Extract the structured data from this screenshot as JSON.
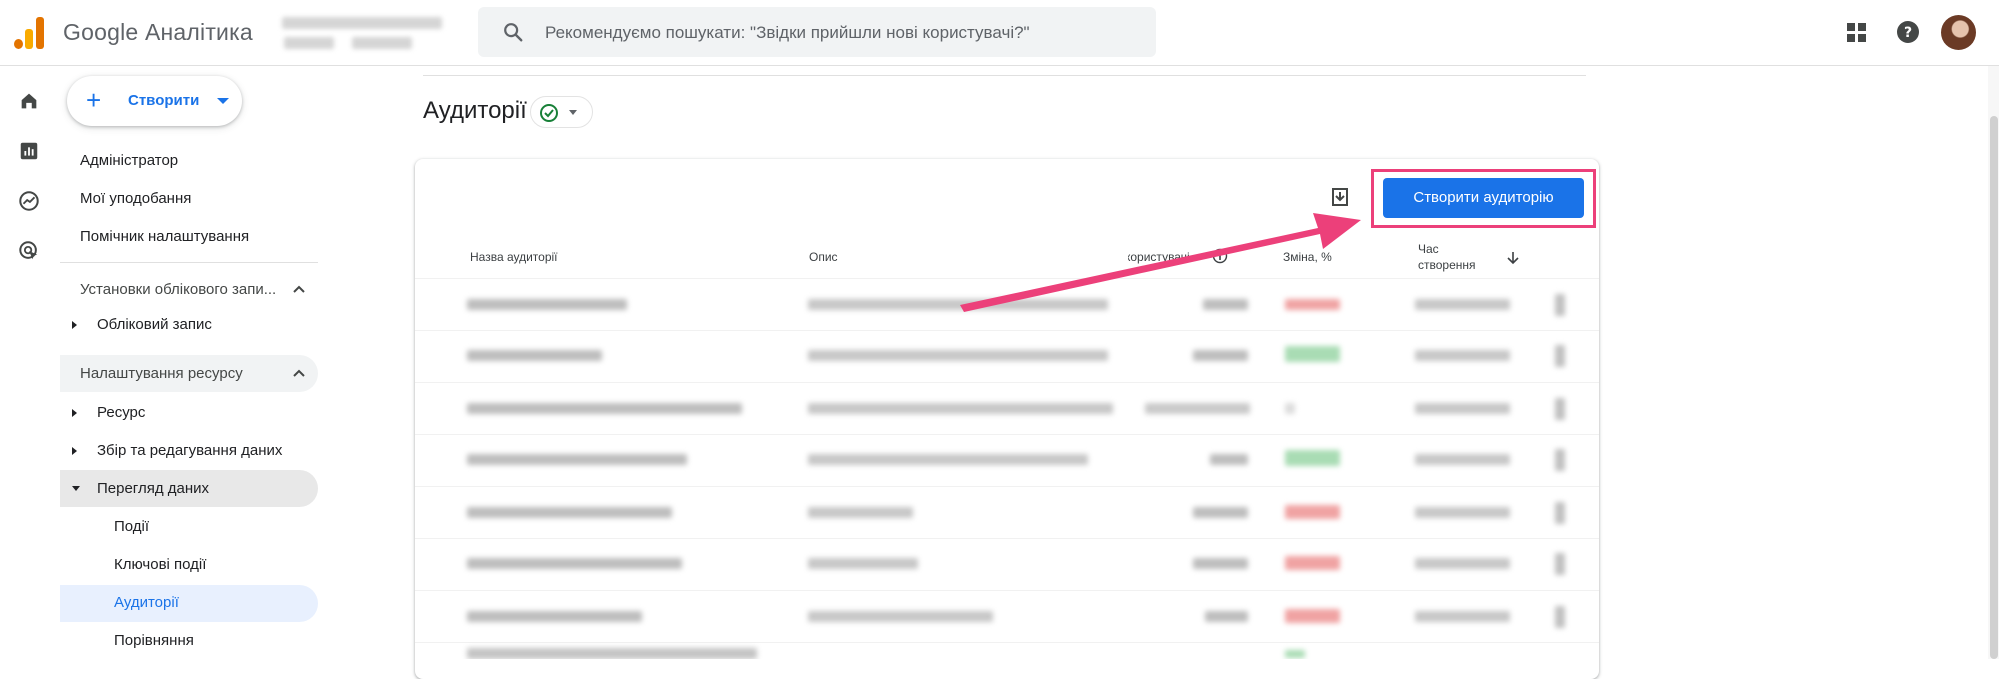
{
  "header": {
    "app_title": "Google Аналітика",
    "search_placeholder": "Рекомендуємо пошукати: \"Звідки прийшли нові користувачі?\""
  },
  "nav": {
    "create_label": "Створити",
    "items": [
      "Адміністратор",
      "Мої уподобання",
      "Помічник налаштування"
    ],
    "account_section": "Установки облікового запи...",
    "account_item": "Обліковий запис",
    "property_section": "Налаштування ресурсу",
    "property_items": [
      "Ресурс",
      "Збір та редагування даних",
      "Перегляд даних"
    ],
    "data_display_children": [
      "Події",
      "Ключові події",
      "Аудиторії",
      "Порівняння"
    ],
    "selected": "Аудиторії"
  },
  "main": {
    "page_title": "Аудиторії",
    "create_audience_label": "Створити аудиторію",
    "columns": {
      "name": "Назва аудиторії",
      "description": "Опис",
      "users": "користувачі",
      "change": "Зміна, %",
      "created_line1": "Час",
      "created_line2": "створення"
    },
    "rows": [
      {
        "change": "negative"
      },
      {
        "change": "positive"
      },
      {
        "change": "none"
      },
      {
        "change": "positive"
      },
      {
        "change": "negative"
      },
      {
        "change": "negative"
      },
      {
        "change": "negative"
      },
      {
        "change": "positive"
      }
    ]
  },
  "colors": {
    "accent": "#1a73e8",
    "highlight": "#ec407a",
    "selected_nav_bg": "#e8f0fe",
    "section_bg": "#f1f3f4",
    "positive": "#8fd19e",
    "negative": "#f0a3a3"
  },
  "icons": [
    "analytics-logo-icon",
    "search-icon",
    "apps-grid-icon",
    "help-icon",
    "home-icon",
    "reports-icon",
    "explore-icon",
    "advertising-icon",
    "check-circle-icon",
    "download-icon",
    "sort-arrow-icon",
    "info-icon"
  ]
}
